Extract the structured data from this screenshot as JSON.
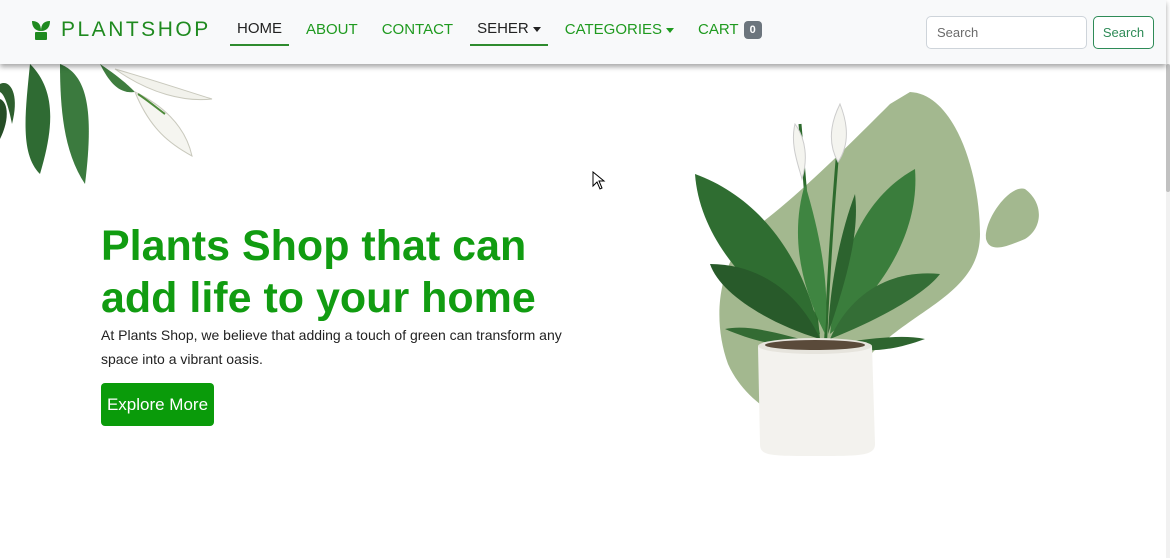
{
  "brand": {
    "name": "PLANTSHOP",
    "icon": "seedling-icon",
    "color": "#1f8a1f"
  },
  "nav": {
    "items": [
      {
        "label": "HOME",
        "active": true
      },
      {
        "label": "ABOUT",
        "active": false
      },
      {
        "label": "CONTACT",
        "active": false
      },
      {
        "label": "SEHER",
        "active": true,
        "dropdown": true
      },
      {
        "label": "CATEGORIES",
        "active": false,
        "dropdown": true
      },
      {
        "label": "CART",
        "active": false,
        "badge": "0"
      }
    ]
  },
  "search": {
    "placeholder": "Search",
    "value": "",
    "button_label": "Search"
  },
  "hero": {
    "title": "Plants Shop that can add life to your home",
    "text": "At Plants Shop, we believe that adding a touch of green can transform any space into a vibrant oasis.",
    "button_label": "Explore More"
  },
  "colors": {
    "accent": "#0a9b0a",
    "blob": "#a3b88f",
    "nav_bg": "#f8f9fa",
    "badge": "#6c757d"
  }
}
